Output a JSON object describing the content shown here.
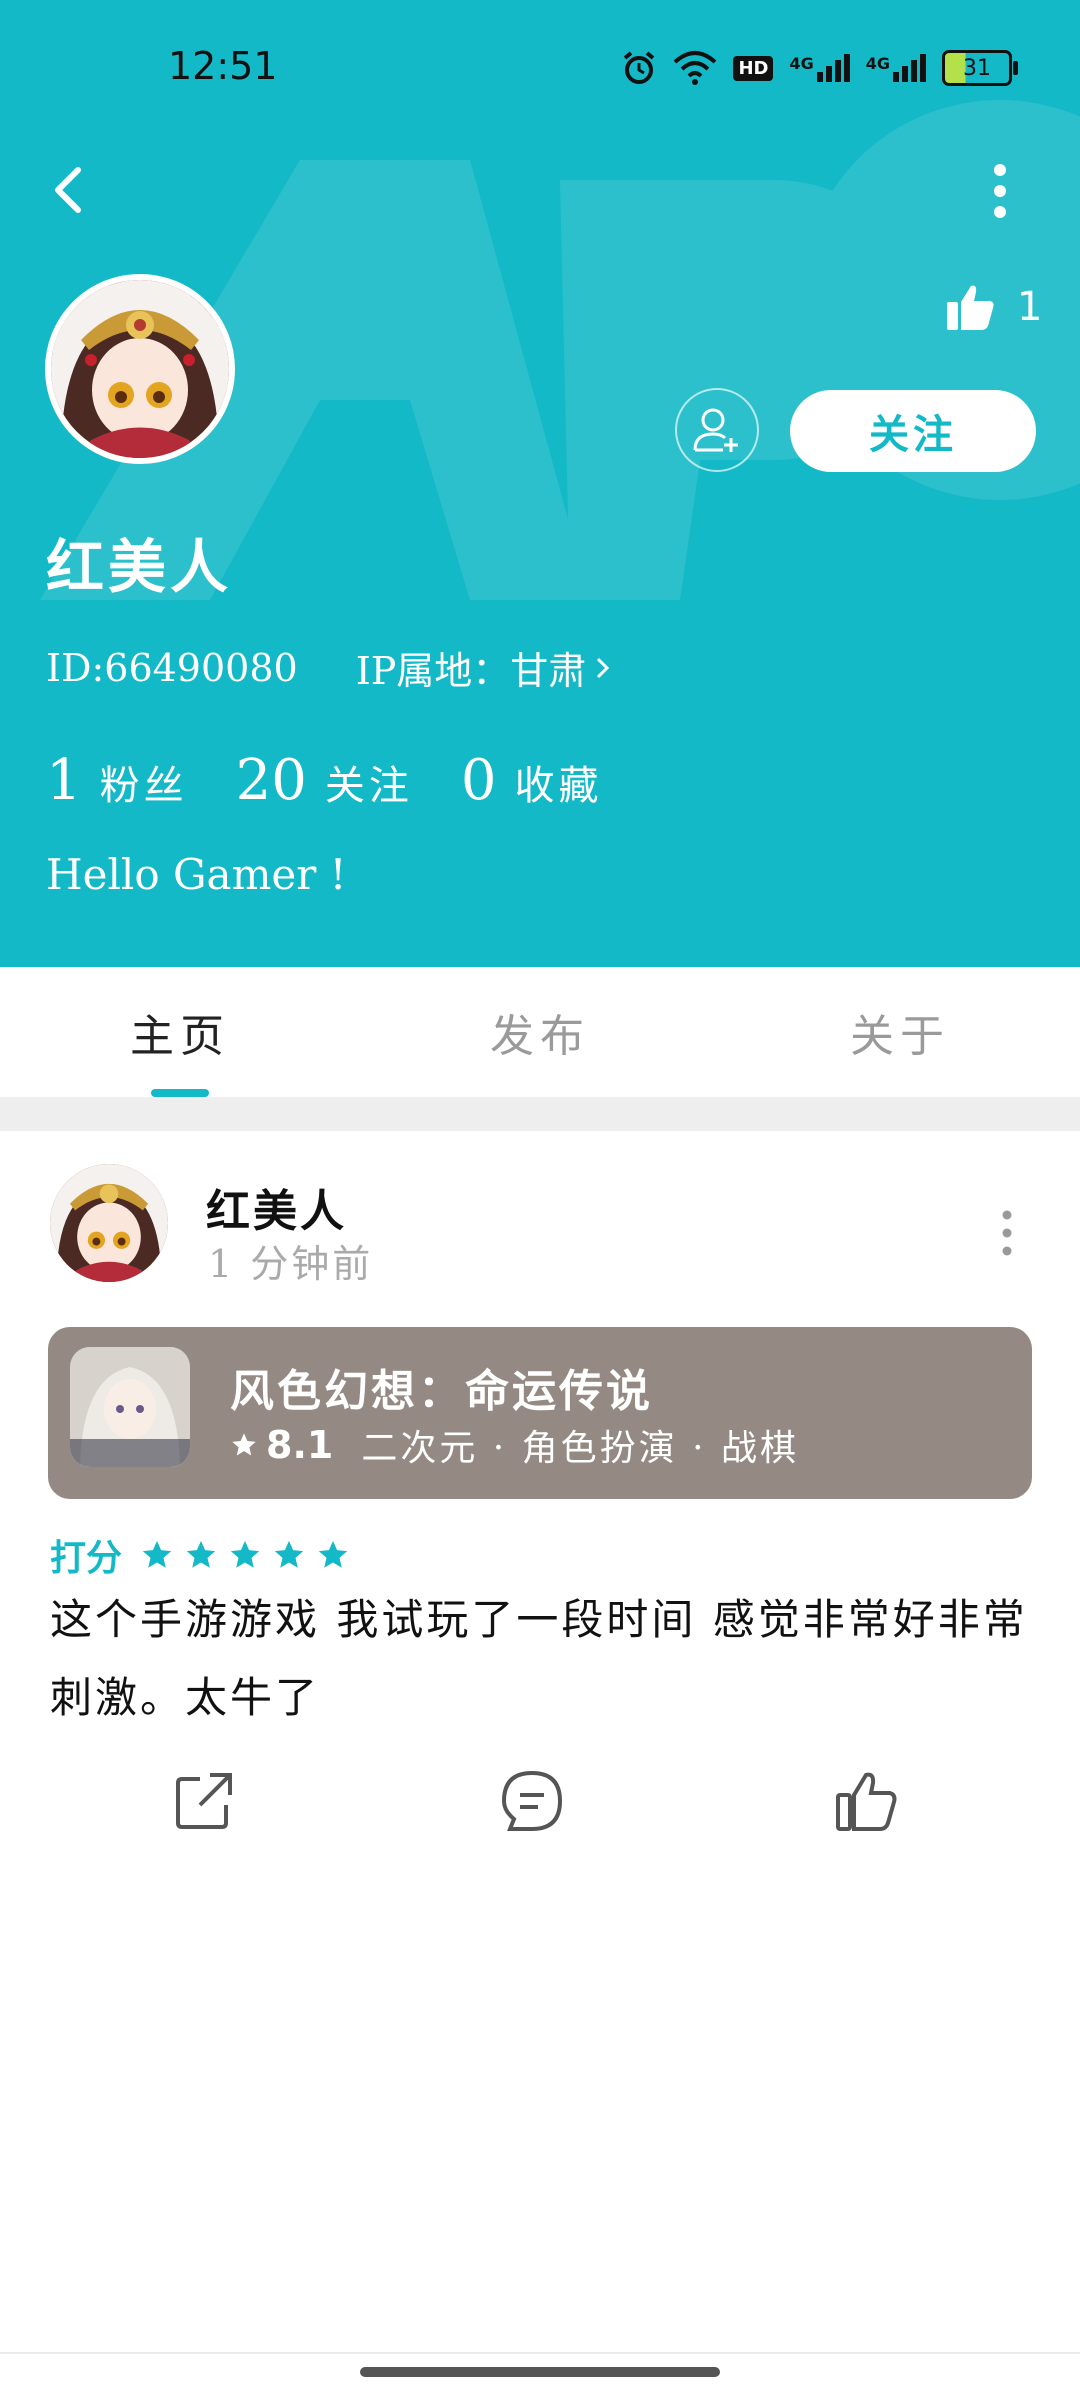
{
  "status_bar": {
    "time": "12:51",
    "hd_label": "HD",
    "signal1_label": "4G",
    "signal2_label": "4G",
    "battery": "31"
  },
  "header": {
    "like_count": "1",
    "follow_label": "关注",
    "username": "红美人",
    "id_text": "ID:66490080",
    "ip_text": "IP属地：甘肃",
    "stats": [
      {
        "num": "1",
        "label": "粉丝"
      },
      {
        "num": "20",
        "label": "关注"
      },
      {
        "num": "0",
        "label": "收藏"
      }
    ],
    "bio": "Hello Gamer !",
    "bg_color": "#14b9c8"
  },
  "tabs": [
    {
      "label": "主页",
      "active": true
    },
    {
      "label": "发布",
      "active": false
    },
    {
      "label": "关于",
      "active": false
    }
  ],
  "post": {
    "author": "红美人",
    "time": "1 分钟前",
    "game": {
      "name": "风色幻想：命运传说",
      "score": "8.1",
      "tags": "二次元 · 角色扮演 · 战棋"
    },
    "rating_label": "打分",
    "rating": 5,
    "text": "这个手游游戏 我试玩了一段时间 感觉非常好非常刺激。太牛了"
  },
  "icons": {
    "back": "back-icon",
    "more": "more-icon",
    "like": "thumbs-up-icon",
    "add_friend": "add-friend-icon",
    "share": "share-icon",
    "comment": "comment-icon"
  }
}
